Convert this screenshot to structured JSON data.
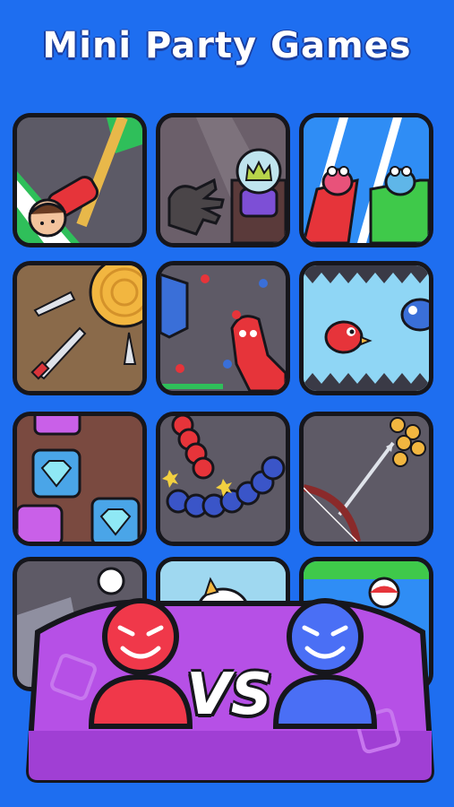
{
  "title": "Mini Party Games",
  "vs_label": "VS",
  "colors": {
    "background": "#1e6ef0",
    "panel": "#b650e6",
    "player_red": "#f0384a",
    "player_blue": "#4a6ff5",
    "outline": "#16161c"
  },
  "games": [
    {
      "icon": "rope-climb-icon"
    },
    {
      "icon": "steal-crown-icon"
    },
    {
      "icon": "frog-race-icon"
    },
    {
      "icon": "knife-throw-icon"
    },
    {
      "icon": "dino-battle-icon"
    },
    {
      "icon": "flappy-bird-icon"
    },
    {
      "icon": "diamond-match-icon"
    },
    {
      "icon": "snake-battle-icon"
    },
    {
      "icon": "archery-icon"
    },
    {
      "icon": "partial-game-icon"
    },
    {
      "icon": "cat-game-icon"
    },
    {
      "icon": "beach-ball-icon"
    }
  ],
  "players": [
    {
      "icon": "red-player-icon"
    },
    {
      "icon": "blue-player-icon"
    }
  ]
}
